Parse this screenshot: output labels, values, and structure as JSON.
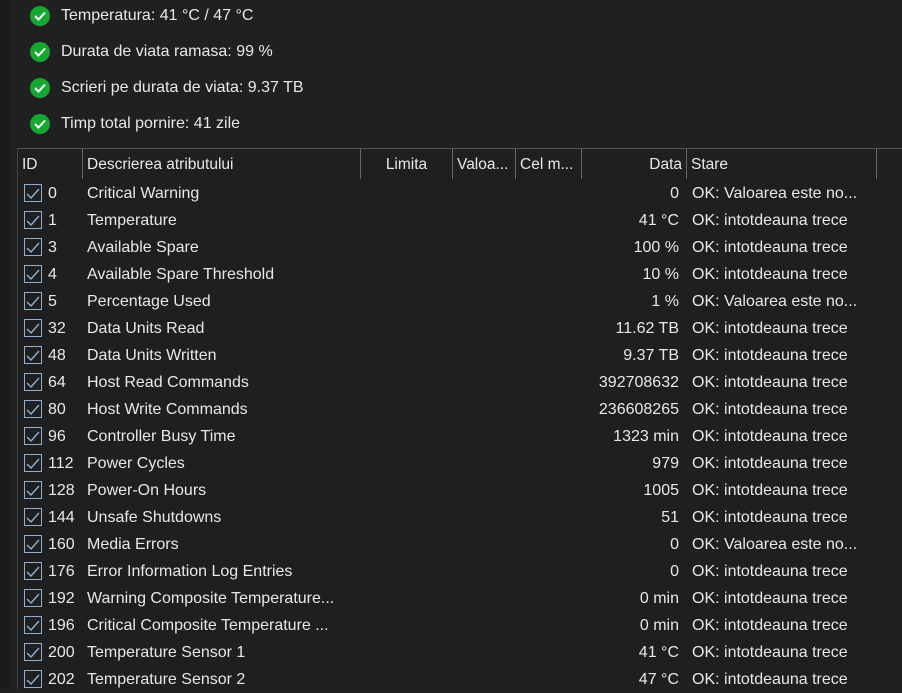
{
  "summary": [
    "Temperatura: 41 °C / 47 °C",
    "Durata de viata ramasa: 99 %",
    "Scrieri pe durata de viata: 9.37 TB",
    "Timp total pornire: 41 zile"
  ],
  "colors": {
    "ok": "#16a832",
    "check": "#8fb0d0"
  },
  "columns": [
    "ID",
    "Descrierea atributului",
    "Limita",
    "Valoa...",
    "Cel m...",
    "Data",
    "Stare"
  ],
  "rows": [
    {
      "id": "0",
      "desc": "Critical Warning",
      "data": "0",
      "state": "OK: Valoarea este no..."
    },
    {
      "id": "1",
      "desc": "Temperature",
      "data": "41 °C",
      "state": "OK: intotdeauna trece"
    },
    {
      "id": "3",
      "desc": "Available Spare",
      "data": "100 %",
      "state": "OK: intotdeauna trece"
    },
    {
      "id": "4",
      "desc": "Available Spare Threshold",
      "data": "10 %",
      "state": "OK: intotdeauna trece"
    },
    {
      "id": "5",
      "desc": "Percentage Used",
      "data": "1 %",
      "state": "OK: Valoarea este no..."
    },
    {
      "id": "32",
      "desc": "Data Units Read",
      "data": "11.62 TB",
      "state": "OK: intotdeauna trece"
    },
    {
      "id": "48",
      "desc": "Data Units Written",
      "data": "9.37 TB",
      "state": "OK: intotdeauna trece"
    },
    {
      "id": "64",
      "desc": "Host Read Commands",
      "data": "392708632",
      "state": "OK: intotdeauna trece"
    },
    {
      "id": "80",
      "desc": "Host Write Commands",
      "data": "236608265",
      "state": "OK: intotdeauna trece"
    },
    {
      "id": "96",
      "desc": "Controller Busy Time",
      "data": "1323 min",
      "state": "OK: intotdeauna trece"
    },
    {
      "id": "112",
      "desc": "Power Cycles",
      "data": "979",
      "state": "OK: intotdeauna trece"
    },
    {
      "id": "128",
      "desc": "Power-On Hours",
      "data": "1005",
      "state": "OK: intotdeauna trece"
    },
    {
      "id": "144",
      "desc": "Unsafe Shutdowns",
      "data": "51",
      "state": "OK: intotdeauna trece"
    },
    {
      "id": "160",
      "desc": "Media Errors",
      "data": "0",
      "state": "OK: Valoarea este no..."
    },
    {
      "id": "176",
      "desc": "Error Information Log Entries",
      "data": "0",
      "state": "OK: intotdeauna trece"
    },
    {
      "id": "192",
      "desc": "Warning Composite Temperature...",
      "data": "0 min",
      "state": "OK: intotdeauna trece"
    },
    {
      "id": "196",
      "desc": "Critical Composite Temperature ...",
      "data": "0 min",
      "state": "OK: intotdeauna trece"
    },
    {
      "id": "200",
      "desc": "Temperature Sensor 1",
      "data": "41 °C",
      "state": "OK: intotdeauna trece"
    },
    {
      "id": "202",
      "desc": "Temperature Sensor 2",
      "data": "47 °C",
      "state": "OK: intotdeauna trece"
    }
  ]
}
